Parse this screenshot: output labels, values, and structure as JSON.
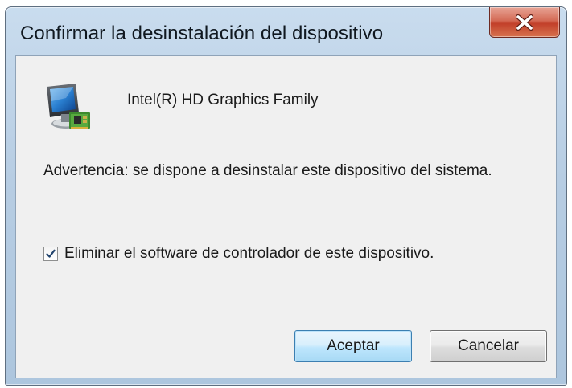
{
  "dialog": {
    "title": "Confirmar la desinstalación del dispositivo",
    "device_icon": "display-adapter-icon",
    "device_name": "Intel(R) HD Graphics Family",
    "warning": "Advertencia: se dispone a desinstalar este dispositivo del sistema.",
    "option": {
      "label": "Eliminar el software de controlador de este dispositivo.",
      "checked": true
    },
    "buttons": {
      "ok": "Aceptar",
      "cancel": "Cancelar"
    }
  },
  "colors": {
    "frame": "#b7cde3",
    "client": "#f0f0f0",
    "close_button": "#c2402a",
    "default_button": "#bee6fd"
  }
}
